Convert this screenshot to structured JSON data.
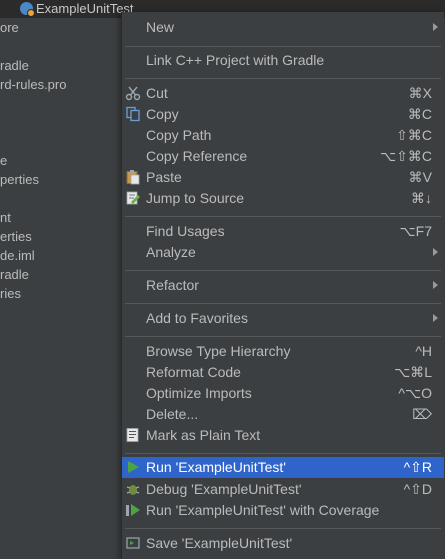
{
  "window": {
    "title": "ExampleUnitTest"
  },
  "tree": {
    "items": [
      {
        "label": "ore"
      },
      {
        "label": "radle"
      },
      {
        "label": "rd-rules.pro"
      },
      {
        "label": "e"
      },
      {
        "label": "perties"
      },
      {
        "label": "nt"
      },
      {
        "label": "erties"
      },
      {
        "label": "de.iml"
      },
      {
        "label": "radle"
      },
      {
        "label": "ries"
      }
    ]
  },
  "menu": {
    "items": [
      {
        "label": "New",
        "shortcut": "",
        "submenu": true,
        "icon": ""
      },
      {
        "label": "Link C++ Project with Gradle",
        "shortcut": "",
        "submenu": false,
        "icon": ""
      },
      {
        "label": "Cut",
        "shortcut": "⌘X",
        "submenu": false,
        "icon": "scissors-icon"
      },
      {
        "label": "Copy",
        "shortcut": "⌘C",
        "submenu": false,
        "icon": "copy-icon"
      },
      {
        "label": "Copy Path",
        "shortcut": "⇧⌘C",
        "submenu": false,
        "icon": ""
      },
      {
        "label": "Copy Reference",
        "shortcut": "⌥⇧⌘C",
        "submenu": false,
        "icon": ""
      },
      {
        "label": "Paste",
        "shortcut": "⌘V",
        "submenu": false,
        "icon": "paste-icon"
      },
      {
        "label": "Jump to Source",
        "shortcut": "⌘↓",
        "submenu": false,
        "icon": "jump-to-source-icon"
      },
      {
        "label": "Find Usages",
        "shortcut": "⌥F7",
        "submenu": false,
        "icon": ""
      },
      {
        "label": "Analyze",
        "shortcut": "",
        "submenu": true,
        "icon": ""
      },
      {
        "label": "Refactor",
        "shortcut": "",
        "submenu": true,
        "icon": ""
      },
      {
        "label": "Add to Favorites",
        "shortcut": "",
        "submenu": true,
        "icon": ""
      },
      {
        "label": "Browse Type Hierarchy",
        "shortcut": "^H",
        "submenu": false,
        "icon": ""
      },
      {
        "label": "Reformat Code",
        "shortcut": "⌥⌘L",
        "submenu": false,
        "icon": ""
      },
      {
        "label": "Optimize Imports",
        "shortcut": "^⌥O",
        "submenu": false,
        "icon": ""
      },
      {
        "label": "Delete...",
        "shortcut": "⌦",
        "submenu": false,
        "icon": ""
      },
      {
        "label": "Mark as Plain Text",
        "shortcut": "",
        "submenu": false,
        "icon": "plain-text-icon"
      },
      {
        "label": "Run 'ExampleUnitTest'",
        "shortcut": "^⇧R",
        "submenu": false,
        "icon": "run-icon",
        "selected": true
      },
      {
        "label": "Debug 'ExampleUnitTest'",
        "shortcut": "^⇧D",
        "submenu": false,
        "icon": "debug-icon"
      },
      {
        "label": "Run 'ExampleUnitTest' with Coverage",
        "shortcut": "",
        "submenu": false,
        "icon": "coverage-icon"
      },
      {
        "label": "Save 'ExampleUnitTest'",
        "shortcut": "",
        "submenu": false,
        "icon": "save-config-icon"
      }
    ]
  },
  "colors": {
    "background": "#3c3f41",
    "selection": "#2f65ca",
    "separator": "#555759",
    "run_green": "#4ca543"
  }
}
